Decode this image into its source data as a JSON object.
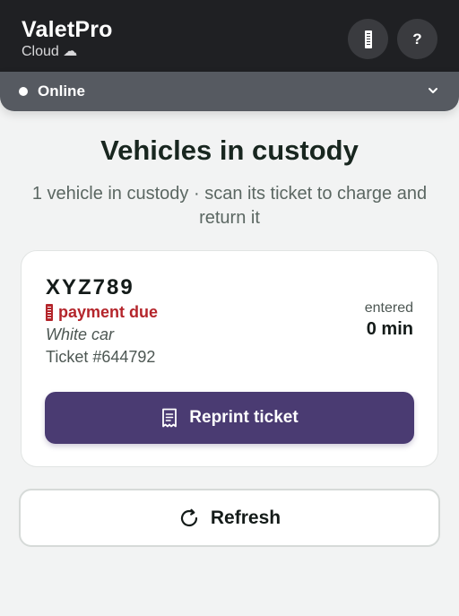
{
  "header": {
    "app_name": "ValetPro",
    "mode_label": "Cloud ☁",
    "help_label": "?"
  },
  "status": {
    "label": "Online"
  },
  "main": {
    "title": "Vehicles in custody",
    "subtitle": "1 vehicle in custody · scan its ticket to charge and return it"
  },
  "vehicle": {
    "plate": "XYZ789",
    "payment_status": "payment due",
    "description": "White car",
    "ticket": "Ticket #644792",
    "entered_label": "entered",
    "entered_value": "0 min",
    "reprint_label": "Reprint ticket"
  },
  "actions": {
    "refresh_label": "Refresh"
  },
  "colors": {
    "topbar": "#1f2023",
    "statusbar": "#565a61",
    "primary_button": "#4a3b72",
    "payment_due": "#b4252b"
  }
}
